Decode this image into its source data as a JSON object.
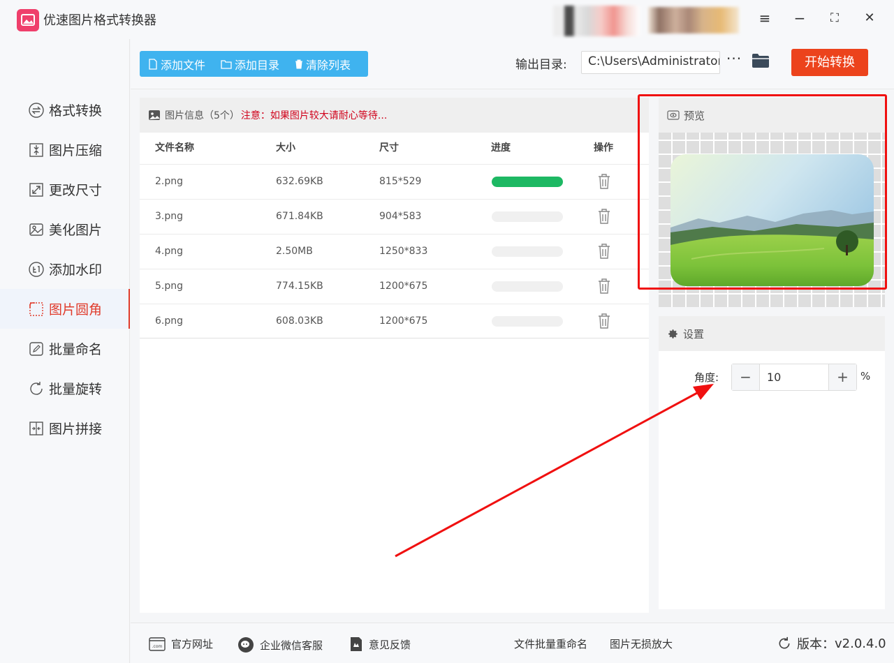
{
  "app": {
    "title": "优速图片格式转换器"
  },
  "window_controls": {
    "menu": "≡",
    "minimize": "−",
    "maximize": "⛶",
    "close": "✕"
  },
  "sidebar": {
    "items": [
      {
        "label": "格式转换",
        "icon": "swap-icon"
      },
      {
        "label": "图片压缩",
        "icon": "compress-icon"
      },
      {
        "label": "更改尺寸",
        "icon": "resize-icon"
      },
      {
        "label": "美化图片",
        "icon": "beautify-icon"
      },
      {
        "label": "添加水印",
        "icon": "watermark-icon"
      },
      {
        "label": "图片圆角",
        "icon": "rounded-corner-icon",
        "active": true
      },
      {
        "label": "批量命名",
        "icon": "rename-icon"
      },
      {
        "label": "批量旋转",
        "icon": "rotate-icon"
      },
      {
        "label": "图片拼接",
        "icon": "stitch-icon"
      }
    ]
  },
  "toolbar": {
    "add_file": "添加文件",
    "add_dir": "添加目录",
    "clear_list": "清除列表",
    "output_label": "输出目录:",
    "output_path": "C:\\Users\\Administrator\\",
    "more": "···",
    "start": "开始转换"
  },
  "file_list": {
    "header_title": "图片信息（5个）",
    "notice": "注意：如果图片较大请耐心等待...",
    "columns": [
      "文件名称",
      "大小",
      "尺寸",
      "进度",
      "操作"
    ],
    "rows": [
      {
        "name": "2.png",
        "size": "632.69KB",
        "dims": "815*529",
        "progress": 1.0
      },
      {
        "name": "3.png",
        "size": "671.84KB",
        "dims": "904*583",
        "progress": 0
      },
      {
        "name": "4.png",
        "size": "2.50MB",
        "dims": "1250*833",
        "progress": 0
      },
      {
        "name": "5.png",
        "size": "774.15KB",
        "dims": "1200*675",
        "progress": 0
      },
      {
        "name": "6.png",
        "size": "608.03KB",
        "dims": "1200*675",
        "progress": 0
      }
    ]
  },
  "preview": {
    "title": "预览"
  },
  "settings": {
    "title": "设置",
    "angle_label": "角度:",
    "angle_value": "10",
    "minus": "−",
    "plus": "+",
    "unit": "%"
  },
  "footer": {
    "website": "官方网址",
    "wechat": "企业微信客服",
    "feedback": "意见反馈",
    "batch_rename": "文件批量重命名",
    "lossless_zoom": "图片无损放大",
    "version_label": "版本：",
    "version": "v2.0.4.0"
  },
  "colors": {
    "accent_blue": "#3fb3ef",
    "start_red": "#ec431c",
    "active_red": "#e03b2b",
    "progress_green": "#1db863",
    "annotation_red": "#f01010"
  }
}
